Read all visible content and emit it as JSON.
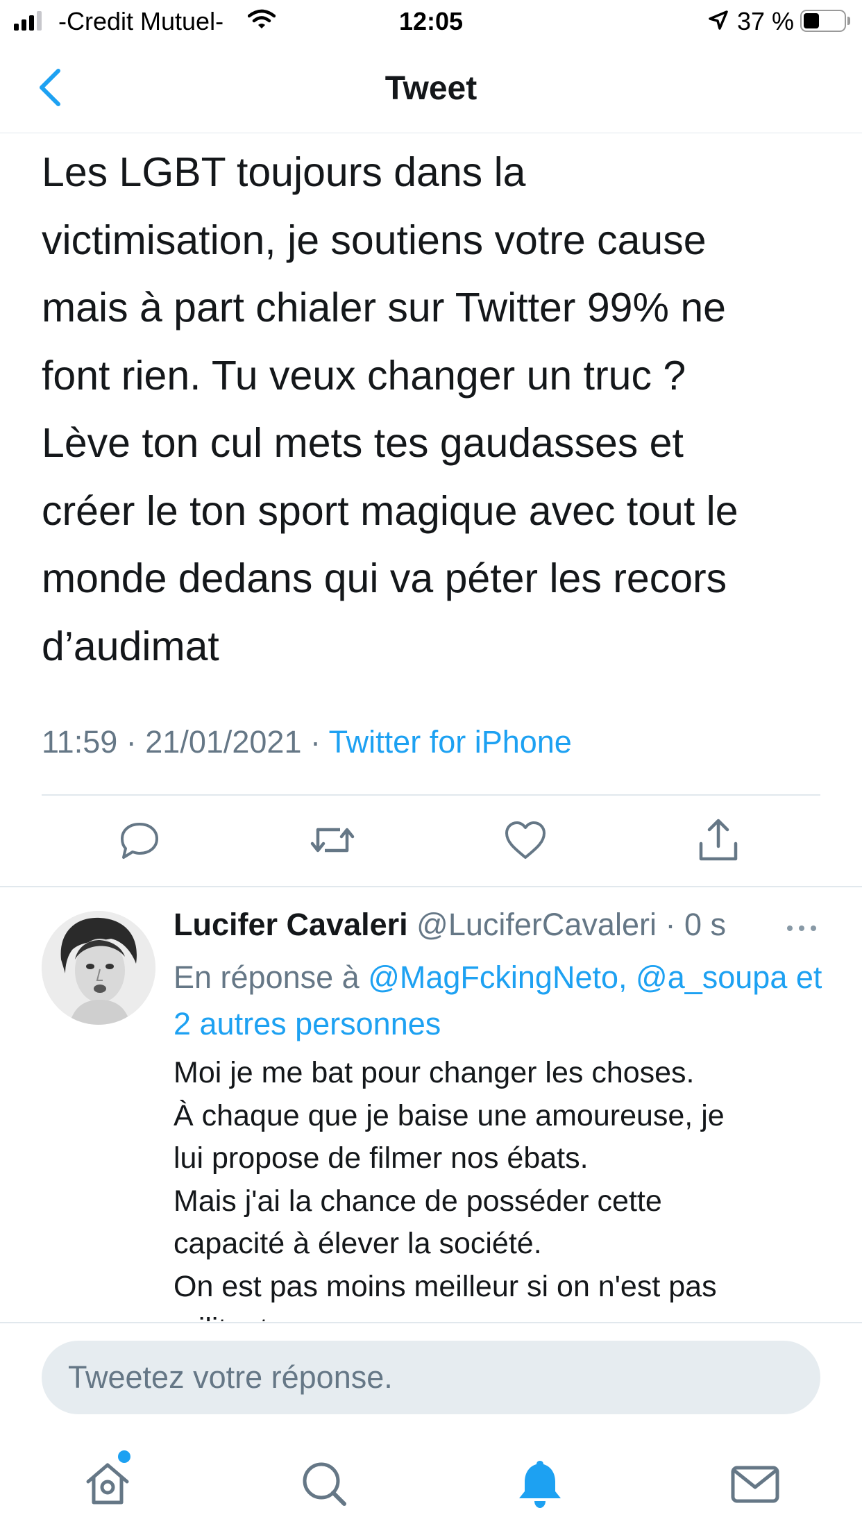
{
  "status_bar": {
    "carrier": "-Credit Mutuel-",
    "time": "12:05",
    "battery": "37 %",
    "battery_level": 0.37
  },
  "nav": {
    "title": "Tweet",
    "back_icon": "chevron-left-icon"
  },
  "tweet": {
    "text": "Les LGBT toujours dans la\nvictimisation, je soutiens votre cause\nmais à part chialer sur Twitter 99% ne\nfont rien. Tu veux changer un truc ?\nLève ton cul mets tes gaudasses et\ncréer le ton sport magique avec tout le\nmonde dedans qui va péter les recors\nd’audimat",
    "time": "11:59 · 21/01/2021 · ",
    "source": "Twitter for iPhone",
    "actions": [
      "reply-icon",
      "retweet-icon",
      "like-icon",
      "share-icon"
    ]
  },
  "reply": {
    "name": "Lucifer Cavaleri",
    "handle": " @LuciferCavaleri · 0 s",
    "reply_prefix": "En réponse à ",
    "mentions": "@MagFckingNeto, @a_soupa et 2 autres personnes",
    "text": "Moi je me bat pour changer les choses.\nÀ chaque que je baise une amoureuse, je\nlui propose de filmer nos ébats.\nMais j'ai la chance de posséder cette\ncapacité à élever la société.\nOn est pas moins meilleur si on n'est pas\nmilitant."
  },
  "composer": {
    "placeholder": "Tweetez votre réponse."
  },
  "tabbar": {
    "items": [
      "home-icon",
      "search-icon",
      "notifications-icon",
      "messages-icon"
    ],
    "active": "notifications-icon"
  },
  "colors": {
    "accent": "#1da1f2",
    "secondary_text": "#657786",
    "divider": "#e1e8ed",
    "composer_bg": "#e6ecf0"
  }
}
